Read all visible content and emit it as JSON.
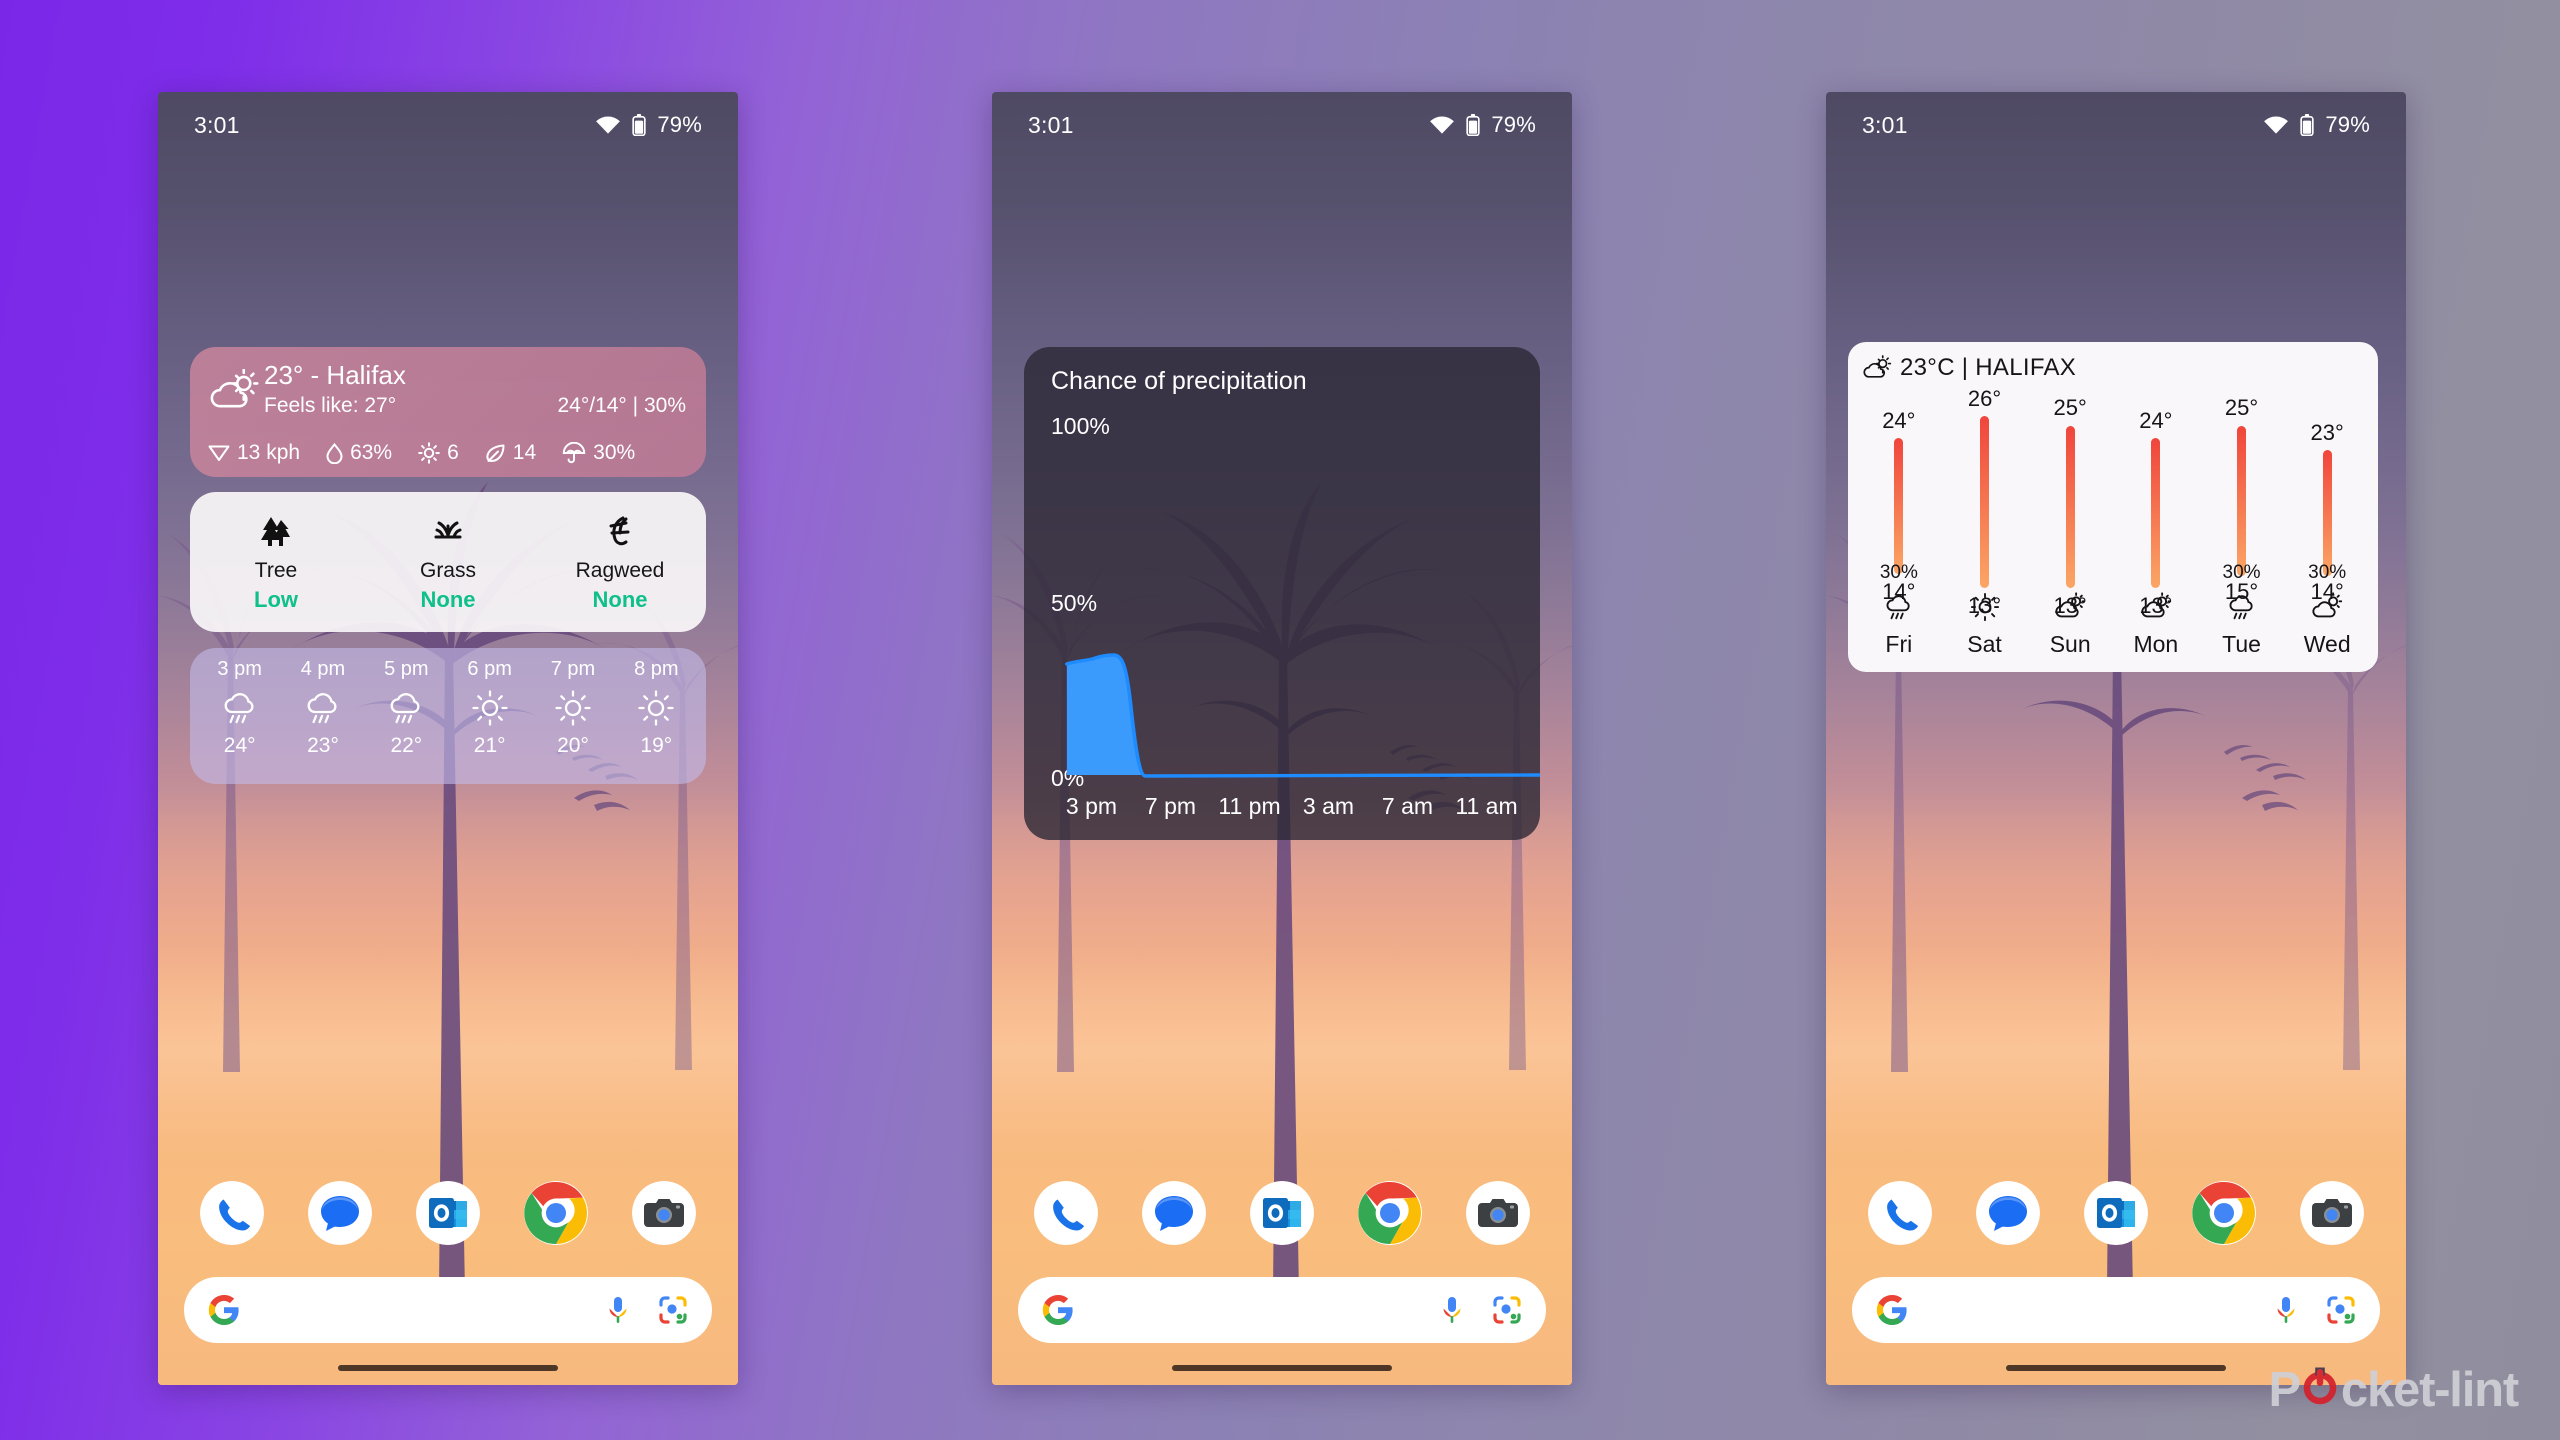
{
  "background": {
    "gradient_from": "#7B27E8",
    "gradient_to": "#908E9E"
  },
  "watermark": {
    "text_before": "P",
    "text_after": "cket-lint",
    "accent_color": "#D5202C"
  },
  "status_bar": {
    "time": "3:01",
    "wifi_icon": "wifi-icon",
    "battery_icon": "battery-icon",
    "battery_percent": "79%"
  },
  "dock": {
    "apps": [
      {
        "name": "Phone",
        "icon": "phone-icon"
      },
      {
        "name": "Messages",
        "icon": "messages-icon"
      },
      {
        "name": "Outlook",
        "icon": "outlook-icon"
      },
      {
        "name": "Chrome",
        "icon": "chrome-icon"
      },
      {
        "name": "Camera",
        "icon": "camera-icon"
      }
    ]
  },
  "search": {
    "value": "",
    "placeholder": "",
    "google_icon": "google-g-icon",
    "mic_icon": "microphone-icon",
    "lens_icon": "google-lens-icon"
  },
  "phone1": {
    "current_weather": {
      "condition_icon": "partly-cloudy-icon",
      "location_line": "23° - Halifax",
      "feels_like": "Feels like: 27°",
      "high_low_precip": "24°/14° | 30%",
      "metrics": [
        {
          "icon": "wind-icon",
          "value": "13 kph"
        },
        {
          "icon": "humidity-icon",
          "value": "63%"
        },
        {
          "icon": "uv-icon",
          "value": "6"
        },
        {
          "icon": "aqi-leaf-icon",
          "value": "14"
        },
        {
          "icon": "umbrella-icon",
          "value": "30%"
        }
      ]
    },
    "pollen": {
      "items": [
        {
          "icon": "tree-icon",
          "name": "Tree",
          "level": "Low"
        },
        {
          "icon": "grass-icon",
          "name": "Grass",
          "level": "None"
        },
        {
          "icon": "ragweed-icon",
          "name": "Ragweed",
          "level": "None"
        }
      ],
      "level_color": "#0EC08A"
    },
    "hourly": {
      "hours": [
        {
          "time": "3 pm",
          "icon": "rain-icon",
          "temp": "24°"
        },
        {
          "time": "4 pm",
          "icon": "rain-icon",
          "temp": "23°"
        },
        {
          "time": "5 pm",
          "icon": "rain-icon",
          "temp": "22°"
        },
        {
          "time": "6 pm",
          "icon": "sunny-icon",
          "temp": "21°"
        },
        {
          "time": "7 pm",
          "icon": "sunny-icon",
          "temp": "20°"
        },
        {
          "time": "8 pm",
          "icon": "sunny-icon",
          "temp": "19°"
        }
      ]
    }
  },
  "phone2": {
    "precip_widget": {
      "title": "Chance of precipitation",
      "line_color": "#1E8BFF"
    }
  },
  "phone3": {
    "forecast_widget": {
      "header_icon": "partly-cloudy-icon",
      "header_text": "23°C | HALIFAX",
      "days": [
        {
          "day": "Fri",
          "high": "24°",
          "low": "14°",
          "precip": "30%",
          "icon": "rain-icon"
        },
        {
          "day": "Sat",
          "high": "26°",
          "low": "13°",
          "precip": "",
          "icon": "sunny-icon"
        },
        {
          "day": "Sun",
          "high": "25°",
          "low": "13°",
          "precip": "",
          "icon": "partly-cloudy-icon"
        },
        {
          "day": "Mon",
          "high": "24°",
          "low": "13°",
          "precip": "",
          "icon": "partly-cloudy-icon"
        },
        {
          "day": "Tue",
          "high": "25°",
          "low": "15°",
          "precip": "30%",
          "icon": "rain-icon"
        },
        {
          "day": "Wed",
          "high": "23°",
          "low": "14°",
          "precip": "30%",
          "icon": "partly-cloudy-icon"
        }
      ],
      "bar_gradient_top": "#F0453C",
      "bar_gradient_bottom": "#FBA665"
    }
  },
  "chart_data": {
    "type": "area",
    "title": "Chance of precipitation",
    "xlabel": "",
    "ylabel": "",
    "ylim": [
      0,
      100
    ],
    "ytick_labels": [
      "100%",
      "50%",
      "0%"
    ],
    "ytick_values": [
      100,
      50,
      0
    ],
    "xtick_labels": [
      "3 pm",
      "7 pm",
      "11 pm",
      "3 am",
      "7 am",
      "11 am"
    ],
    "grid": false,
    "legend": "none",
    "series": [
      {
        "name": "Chance of precipitation",
        "color": "#1E8BFF",
        "x": [
          "3 pm",
          "4 pm",
          "5 pm",
          "6 pm",
          "7 pm",
          "8 pm",
          "9 pm",
          "10 pm",
          "11 pm",
          "12 am",
          "1 am",
          "2 am",
          "3 am",
          "4 am",
          "5 am",
          "6 am",
          "7 am",
          "8 am",
          "9 am",
          "10 am",
          "11 am",
          "12 pm"
        ],
        "values": [
          30,
          30,
          32,
          30,
          0,
          0,
          0,
          0,
          0,
          0,
          0,
          0,
          0,
          0,
          0,
          0,
          0,
          0,
          0,
          0,
          0,
          0
        ]
      }
    ]
  }
}
